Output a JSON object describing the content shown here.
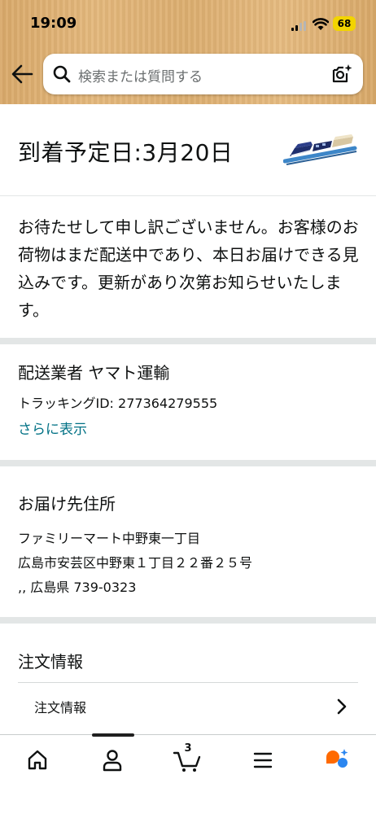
{
  "status_bar": {
    "time": "19:09",
    "battery": "68"
  },
  "search": {
    "placeholder": "検索または質問する"
  },
  "delivery": {
    "eta": "到着予定日:3月20日",
    "notice": "お待たせして申し訳ございません。お客様のお荷物はまだ配送中であり、本日お届けできる見込みです。更新があり次第お知らせいたします。"
  },
  "carrier": {
    "heading": "配送業者 ヤマト運輸",
    "tracking": "トラッキングID: 277364279555",
    "more_link": "さらに表示"
  },
  "address": {
    "heading": "お届け先住所",
    "lines": [
      "ファミリーマート中野東一丁目",
      "広島市安芸区中野東１丁目２２番２５号",
      ",, 広島県 739-0323"
    ]
  },
  "order": {
    "heading": "注文情報",
    "row_label": "注文情報"
  },
  "tabbar": {
    "cart_count": "3",
    "items": [
      "home-icon",
      "account-icon",
      "cart-icon",
      "menu-icon",
      "rufus-icon"
    ]
  },
  "colors": {
    "header": "#e0b275",
    "link": "#007185",
    "battery": "#f2d400",
    "divider": "#e3e6e6",
    "assistant": "#ff6a00"
  }
}
